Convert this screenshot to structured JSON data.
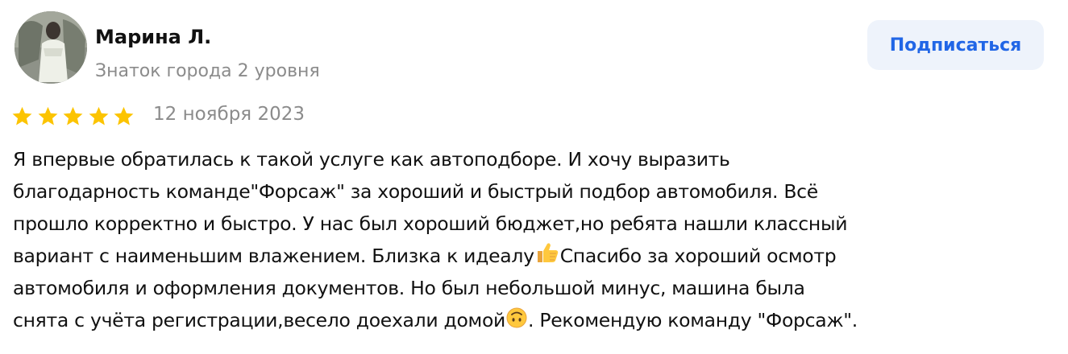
{
  "author": {
    "name": "Марина Л.",
    "level": "Знаток города 2 уровня",
    "avatar_icon": "user-photo-avatar"
  },
  "actions": {
    "subscribe_label": "Подписаться"
  },
  "rating": {
    "stars": 5,
    "max_stars": 5,
    "star_color": "#fcc400"
  },
  "date": "12 ноября 2023",
  "review": {
    "segments": [
      "Я впервые обратилась к такой услуге как автоподборе. И хочу выразить",
      "благодарность команде\"Форсаж\" за хороший и быстрый подбор автомобиля. Всё",
      "прошло корректно и быстро. У нас был хороший бюджет,но ребята нашли классный",
      "вариант с наименьшим влажением. Близка к идеалу",
      "Спасибо за хороший осмотр",
      "автомобиля и оформления документов. Но был небольшой минус, машина была",
      "снята с учёта регистрации,весело доехали домой",
      ". Рекомендую команду \"Форсаж\"."
    ],
    "emojis": [
      "thumbs-up-icon",
      "upside-down-face-icon"
    ]
  },
  "colors": {
    "accent": "#2166e6",
    "button_bg": "#eef3fb",
    "muted_text": "#8b8b8b",
    "text": "#111111"
  }
}
